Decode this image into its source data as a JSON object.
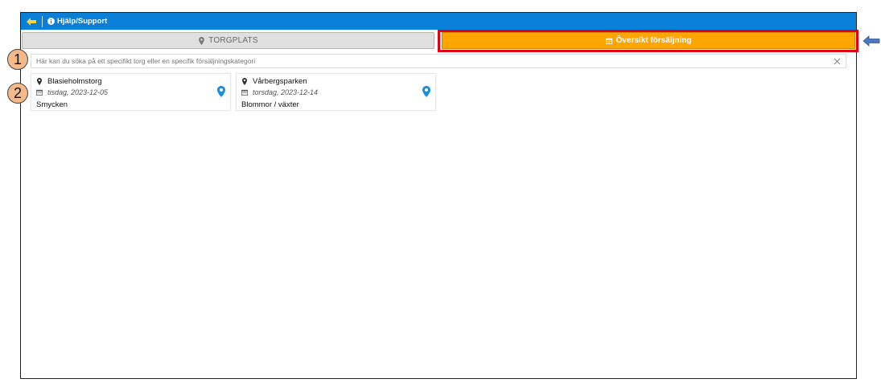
{
  "topbar": {
    "help_label": "Hjälp/Support"
  },
  "tabs": [
    {
      "label": "TORGPLATS",
      "icon": "map-marker-icon"
    },
    {
      "label": "Översikt försäljning",
      "icon": "calendar-icon"
    }
  ],
  "search": {
    "placeholder": "Här kan du söka på ett specifikt torg eller en specifik försäljningskategori",
    "value": ""
  },
  "cards": [
    {
      "name": "Blasieholmstorg",
      "date": "tisdag, 2023-12-05",
      "category": "Smycken"
    },
    {
      "name": "Vårbergsparken",
      "date": "torsdag, 2023-12-14",
      "category": "Blommor / växter"
    }
  ],
  "annotations": {
    "badge_1": "1",
    "badge_2": "2"
  },
  "colors": {
    "topbar": "#0a7fd8",
    "active_tab": "#ffa500",
    "inactive_tab": "#e0e0e0",
    "highlight": "#e00010",
    "pin": "#1a8fe0",
    "badge": "#f5b98a"
  }
}
